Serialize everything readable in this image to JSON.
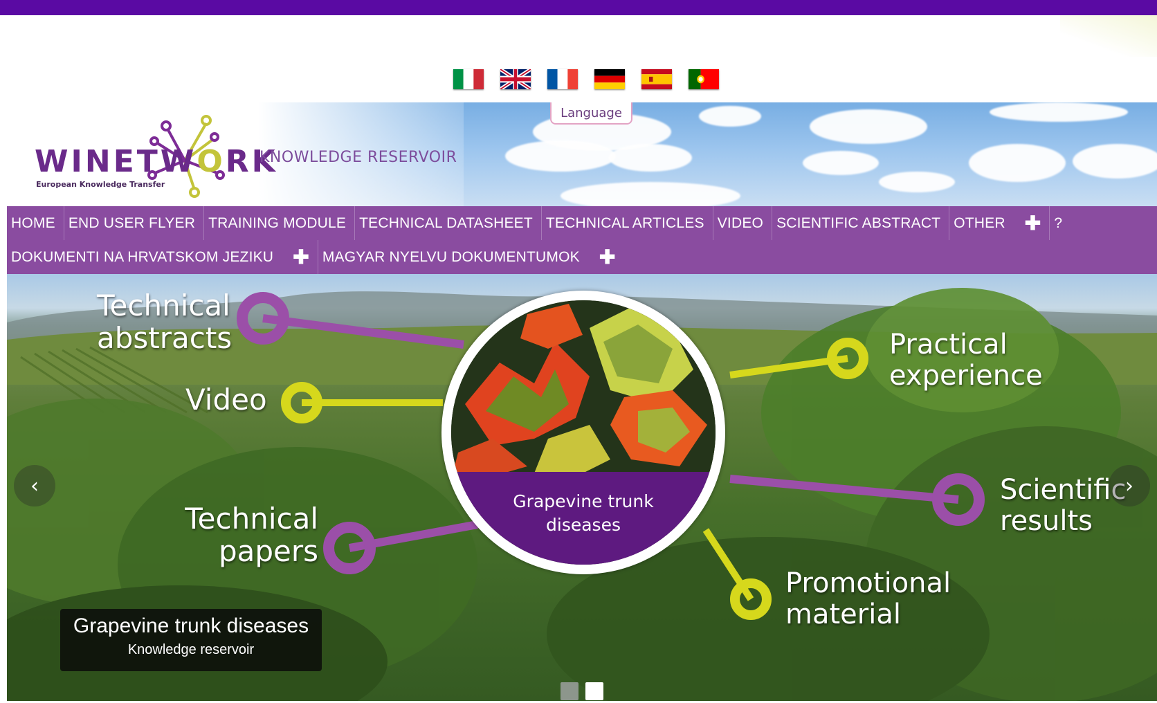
{
  "language_label": "Language",
  "flags": [
    {
      "name": "italian-flag",
      "lang": "Italian"
    },
    {
      "name": "english-flag",
      "lang": "English"
    },
    {
      "name": "french-flag",
      "lang": "French"
    },
    {
      "name": "german-flag",
      "lang": "German"
    },
    {
      "name": "spanish-flag",
      "lang": "Spanish"
    },
    {
      "name": "portuguese-flag",
      "lang": "Portuguese"
    }
  ],
  "logo": {
    "word_a": "WINETW",
    "word_o": "O",
    "word_b": "RK",
    "sub": "European Knowledge Transfer"
  },
  "reservoir_title": "KNOWLEDGE RESERVOIR",
  "nav": {
    "row1": [
      "HOME",
      "END USER FLYER",
      "TRAINING MODULE",
      "TECHNICAL DATASHEET",
      "TECHNICAL ARTICLES",
      "VIDEO",
      "SCIENTIFIC ABSTRACT",
      "OTHER"
    ],
    "plus": "✚",
    "help": "?",
    "row2": [
      "DOKUMENTI NA HRVATSKOM JEZIKU",
      "MAGYAR NYELVU DOKUMENTUMOK"
    ]
  },
  "slide": {
    "labels": {
      "technical_abstracts": [
        "Technical",
        "abstracts"
      ],
      "video": "Video",
      "technical_papers": [
        "Technical",
        "papers"
      ],
      "practical_experience": [
        "Practical",
        "experience"
      ],
      "scientific_results": [
        "Scientific",
        "results"
      ],
      "promotional_material": [
        "Promotional",
        "material"
      ]
    },
    "center_title": [
      "Grapevine trunk",
      "diseases"
    ],
    "caption_title": "Grapevine trunk diseases",
    "caption_sub": "Knowledge reservoir",
    "prev": "‹",
    "next": "›"
  },
  "colors": {
    "top_bar": "#5a0aa3",
    "nav_bg": "#8a4ca0",
    "purple_node": "#9b4fa8",
    "yellow_node": "#d6d81c",
    "center_caption": "#5e1a80"
  }
}
